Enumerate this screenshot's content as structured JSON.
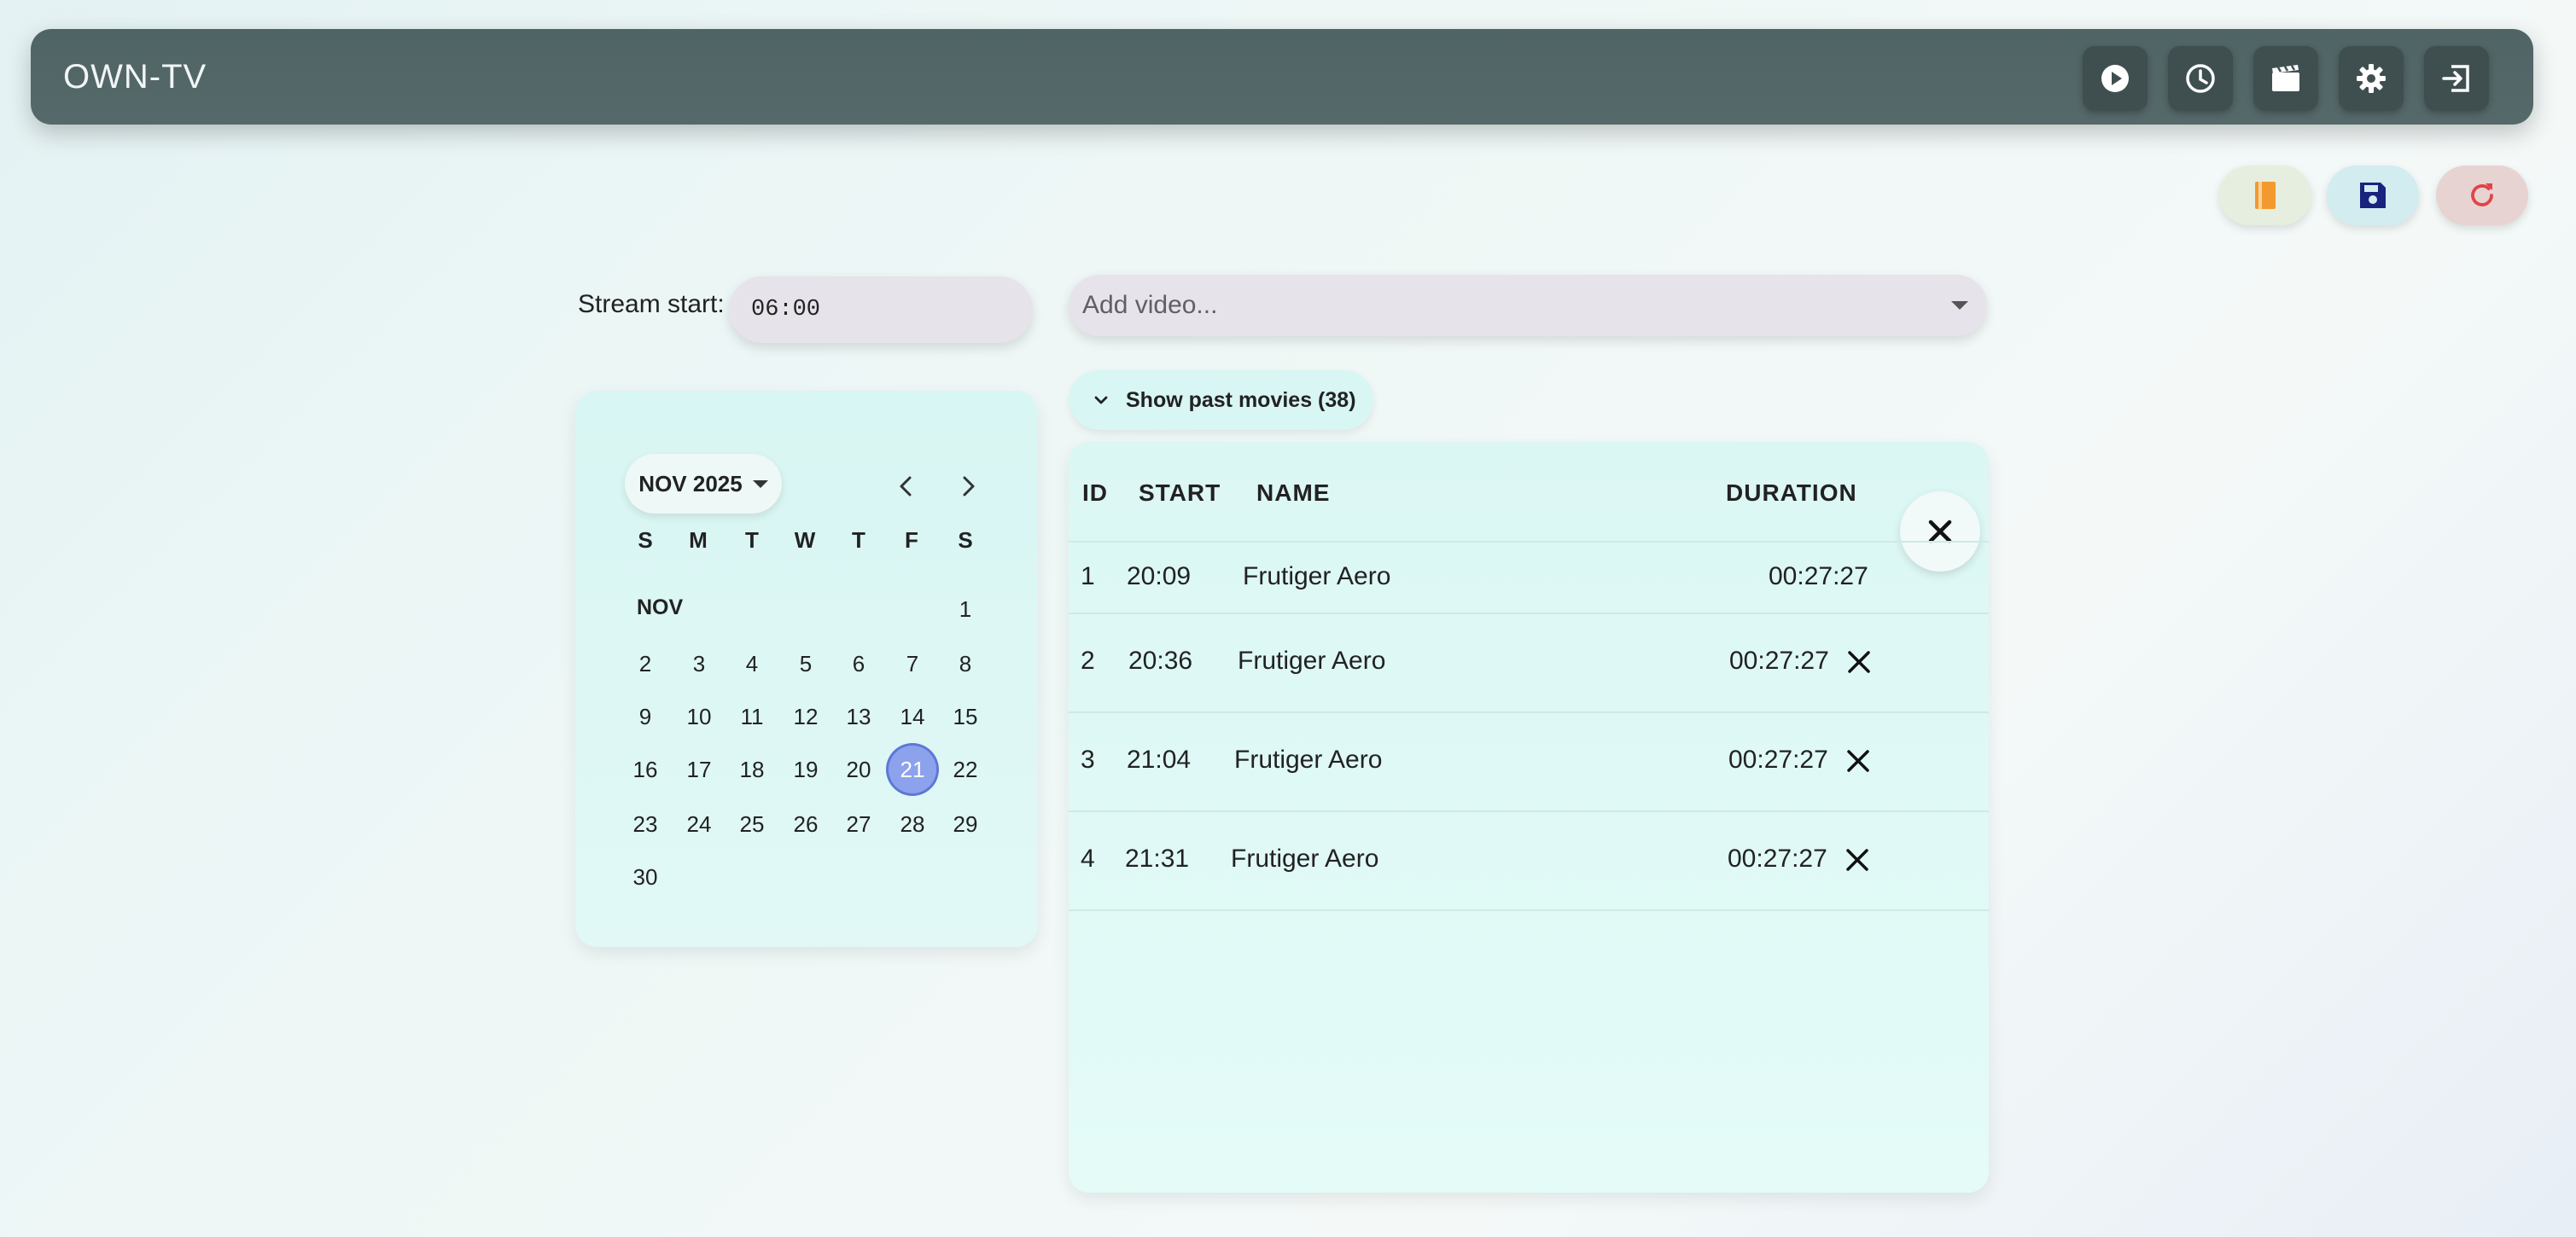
{
  "app": {
    "title": "OWN-TV"
  },
  "nav": [
    {
      "name": "play-icon"
    },
    {
      "name": "clock-icon"
    },
    {
      "name": "movie-icon"
    },
    {
      "name": "gear-icon"
    },
    {
      "name": "logout-icon"
    }
  ],
  "actions": [
    {
      "name": "bookmark-icon",
      "color": "#f29a2e",
      "bg": "#e6eedf"
    },
    {
      "name": "save-icon",
      "color": "#1a237e",
      "bg": "#d2ecf0"
    },
    {
      "name": "refresh-icon",
      "color": "#e04545",
      "bg": "#e8d3d3"
    }
  ],
  "stream": {
    "label": "Stream start:",
    "time": "06:00"
  },
  "add_video": {
    "placeholder": "Add video..."
  },
  "calendar": {
    "month_label": "NOV 2025",
    "short_month": "NOV",
    "weekdays": [
      "S",
      "M",
      "T",
      "W",
      "T",
      "F",
      "S"
    ],
    "first_weekday": 6,
    "days_in_month": 30,
    "selected_day": 21
  },
  "past": {
    "label": "Show past movies (38)"
  },
  "table": {
    "headers": {
      "id": "ID",
      "start": "START",
      "name": "NAME",
      "duration": "DURATION"
    },
    "rows": [
      {
        "id": "1",
        "start": "20:09",
        "name": "Frutiger Aero",
        "duration": "00:27:27",
        "removable": false
      },
      {
        "id": "2",
        "start": "20:36",
        "name": "Frutiger Aero",
        "duration": "00:27:27",
        "removable": true
      },
      {
        "id": "3",
        "start": "21:04",
        "name": "Frutiger Aero",
        "duration": "00:27:27",
        "removable": true
      },
      {
        "id": "4",
        "start": "21:31",
        "name": "Frutiger Aero",
        "duration": "00:27:27",
        "removable": true
      }
    ]
  }
}
